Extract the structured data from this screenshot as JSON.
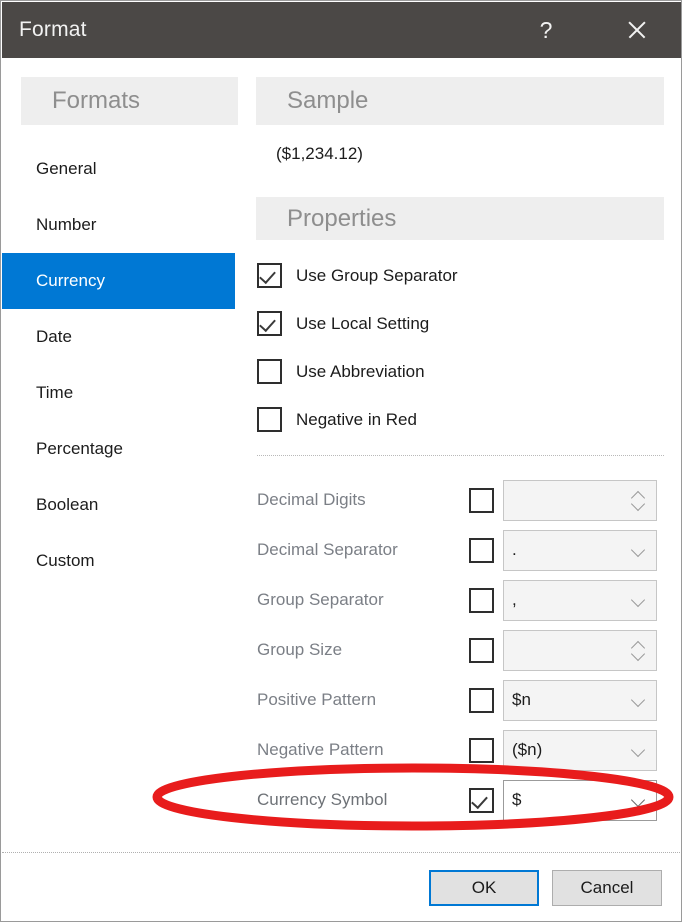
{
  "window": {
    "title": "Format",
    "help_icon": "question-mark-icon",
    "close_icon": "close-icon"
  },
  "sidebar": {
    "header": "Formats",
    "items": [
      {
        "label": "General",
        "selected": false
      },
      {
        "label": "Number",
        "selected": false
      },
      {
        "label": "Currency",
        "selected": true
      },
      {
        "label": "Date",
        "selected": false
      },
      {
        "label": "Time",
        "selected": false
      },
      {
        "label": "Percentage",
        "selected": false
      },
      {
        "label": "Boolean",
        "selected": false
      },
      {
        "label": "Custom",
        "selected": false
      }
    ],
    "selected_color": "#0078d4"
  },
  "sample": {
    "header": "Sample",
    "value": "($1,234.12)"
  },
  "properties": {
    "header": "Properties",
    "checkboxes": [
      {
        "label": "Use Group Separator",
        "checked": true
      },
      {
        "label": "Use Local Setting",
        "checked": true
      },
      {
        "label": "Use Abbreviation",
        "checked": false
      },
      {
        "label": "Negative in Red",
        "checked": false
      }
    ],
    "fields": [
      {
        "label": "Decimal Digits",
        "checked": false,
        "value": "",
        "control": "spinner",
        "enabled": false
      },
      {
        "label": "Decimal Separator",
        "checked": false,
        "value": ".",
        "control": "dropdown",
        "enabled": false
      },
      {
        "label": "Group Separator",
        "checked": false,
        "value": ",",
        "control": "dropdown",
        "enabled": false
      },
      {
        "label": "Group Size",
        "checked": false,
        "value": "",
        "control": "spinner",
        "enabled": false
      },
      {
        "label": "Positive Pattern",
        "checked": false,
        "value": "$n",
        "control": "dropdown",
        "enabled": false
      },
      {
        "label": "Negative Pattern",
        "checked": false,
        "value": "($n)",
        "control": "dropdown",
        "enabled": false
      },
      {
        "label": "Currency Symbol",
        "checked": true,
        "value": "$",
        "control": "dropdown",
        "enabled": true
      }
    ]
  },
  "footer": {
    "ok_label": "OK",
    "cancel_label": "Cancel"
  },
  "annotation": {
    "shape": "ellipse",
    "color": "#e81c1c",
    "target": "Currency Symbol"
  }
}
